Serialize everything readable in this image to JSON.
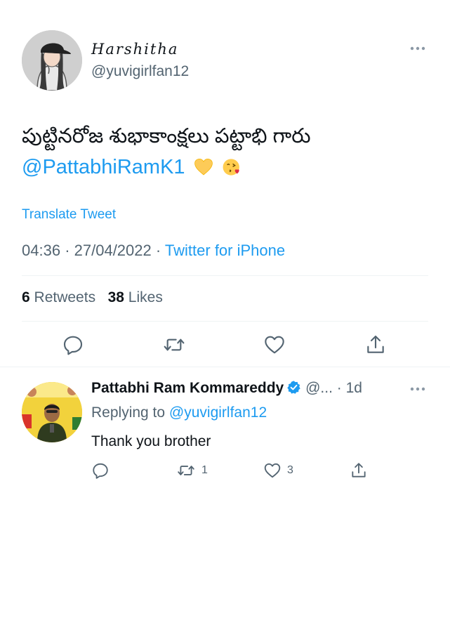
{
  "tweet": {
    "display_name": "Harshitha",
    "handle": "@yuvigirlfan12",
    "text_telugu": "పుట్టినరోజ శుభాకాంక్షలు పట్టాభి గారు",
    "mention": "@PattabhiRamK1",
    "emoji": [
      "yellow-heart-icon",
      "face-blowing-kiss-icon"
    ],
    "translate_label": "Translate Tweet",
    "time": "04:36",
    "date": "27/04/2022",
    "source": "Twitter for iPhone",
    "separator": "·",
    "retweets_count": "6",
    "retweets_label": "Retweets",
    "likes_count": "38",
    "likes_label": "Likes"
  },
  "reply": {
    "display_name": "Pattabhi Ram Kommareddy",
    "handle": "@...",
    "separator": "·",
    "time": "1d",
    "replying_prefix": "Replying to",
    "replying_to": "@yuvigirlfan12",
    "text": "Thank you brother",
    "retweets_count": "1",
    "likes_count": "3"
  },
  "colors": {
    "accent": "#1d9bf0",
    "muted": "#536471",
    "text": "#0f1419",
    "divider": "#eff3f4"
  }
}
